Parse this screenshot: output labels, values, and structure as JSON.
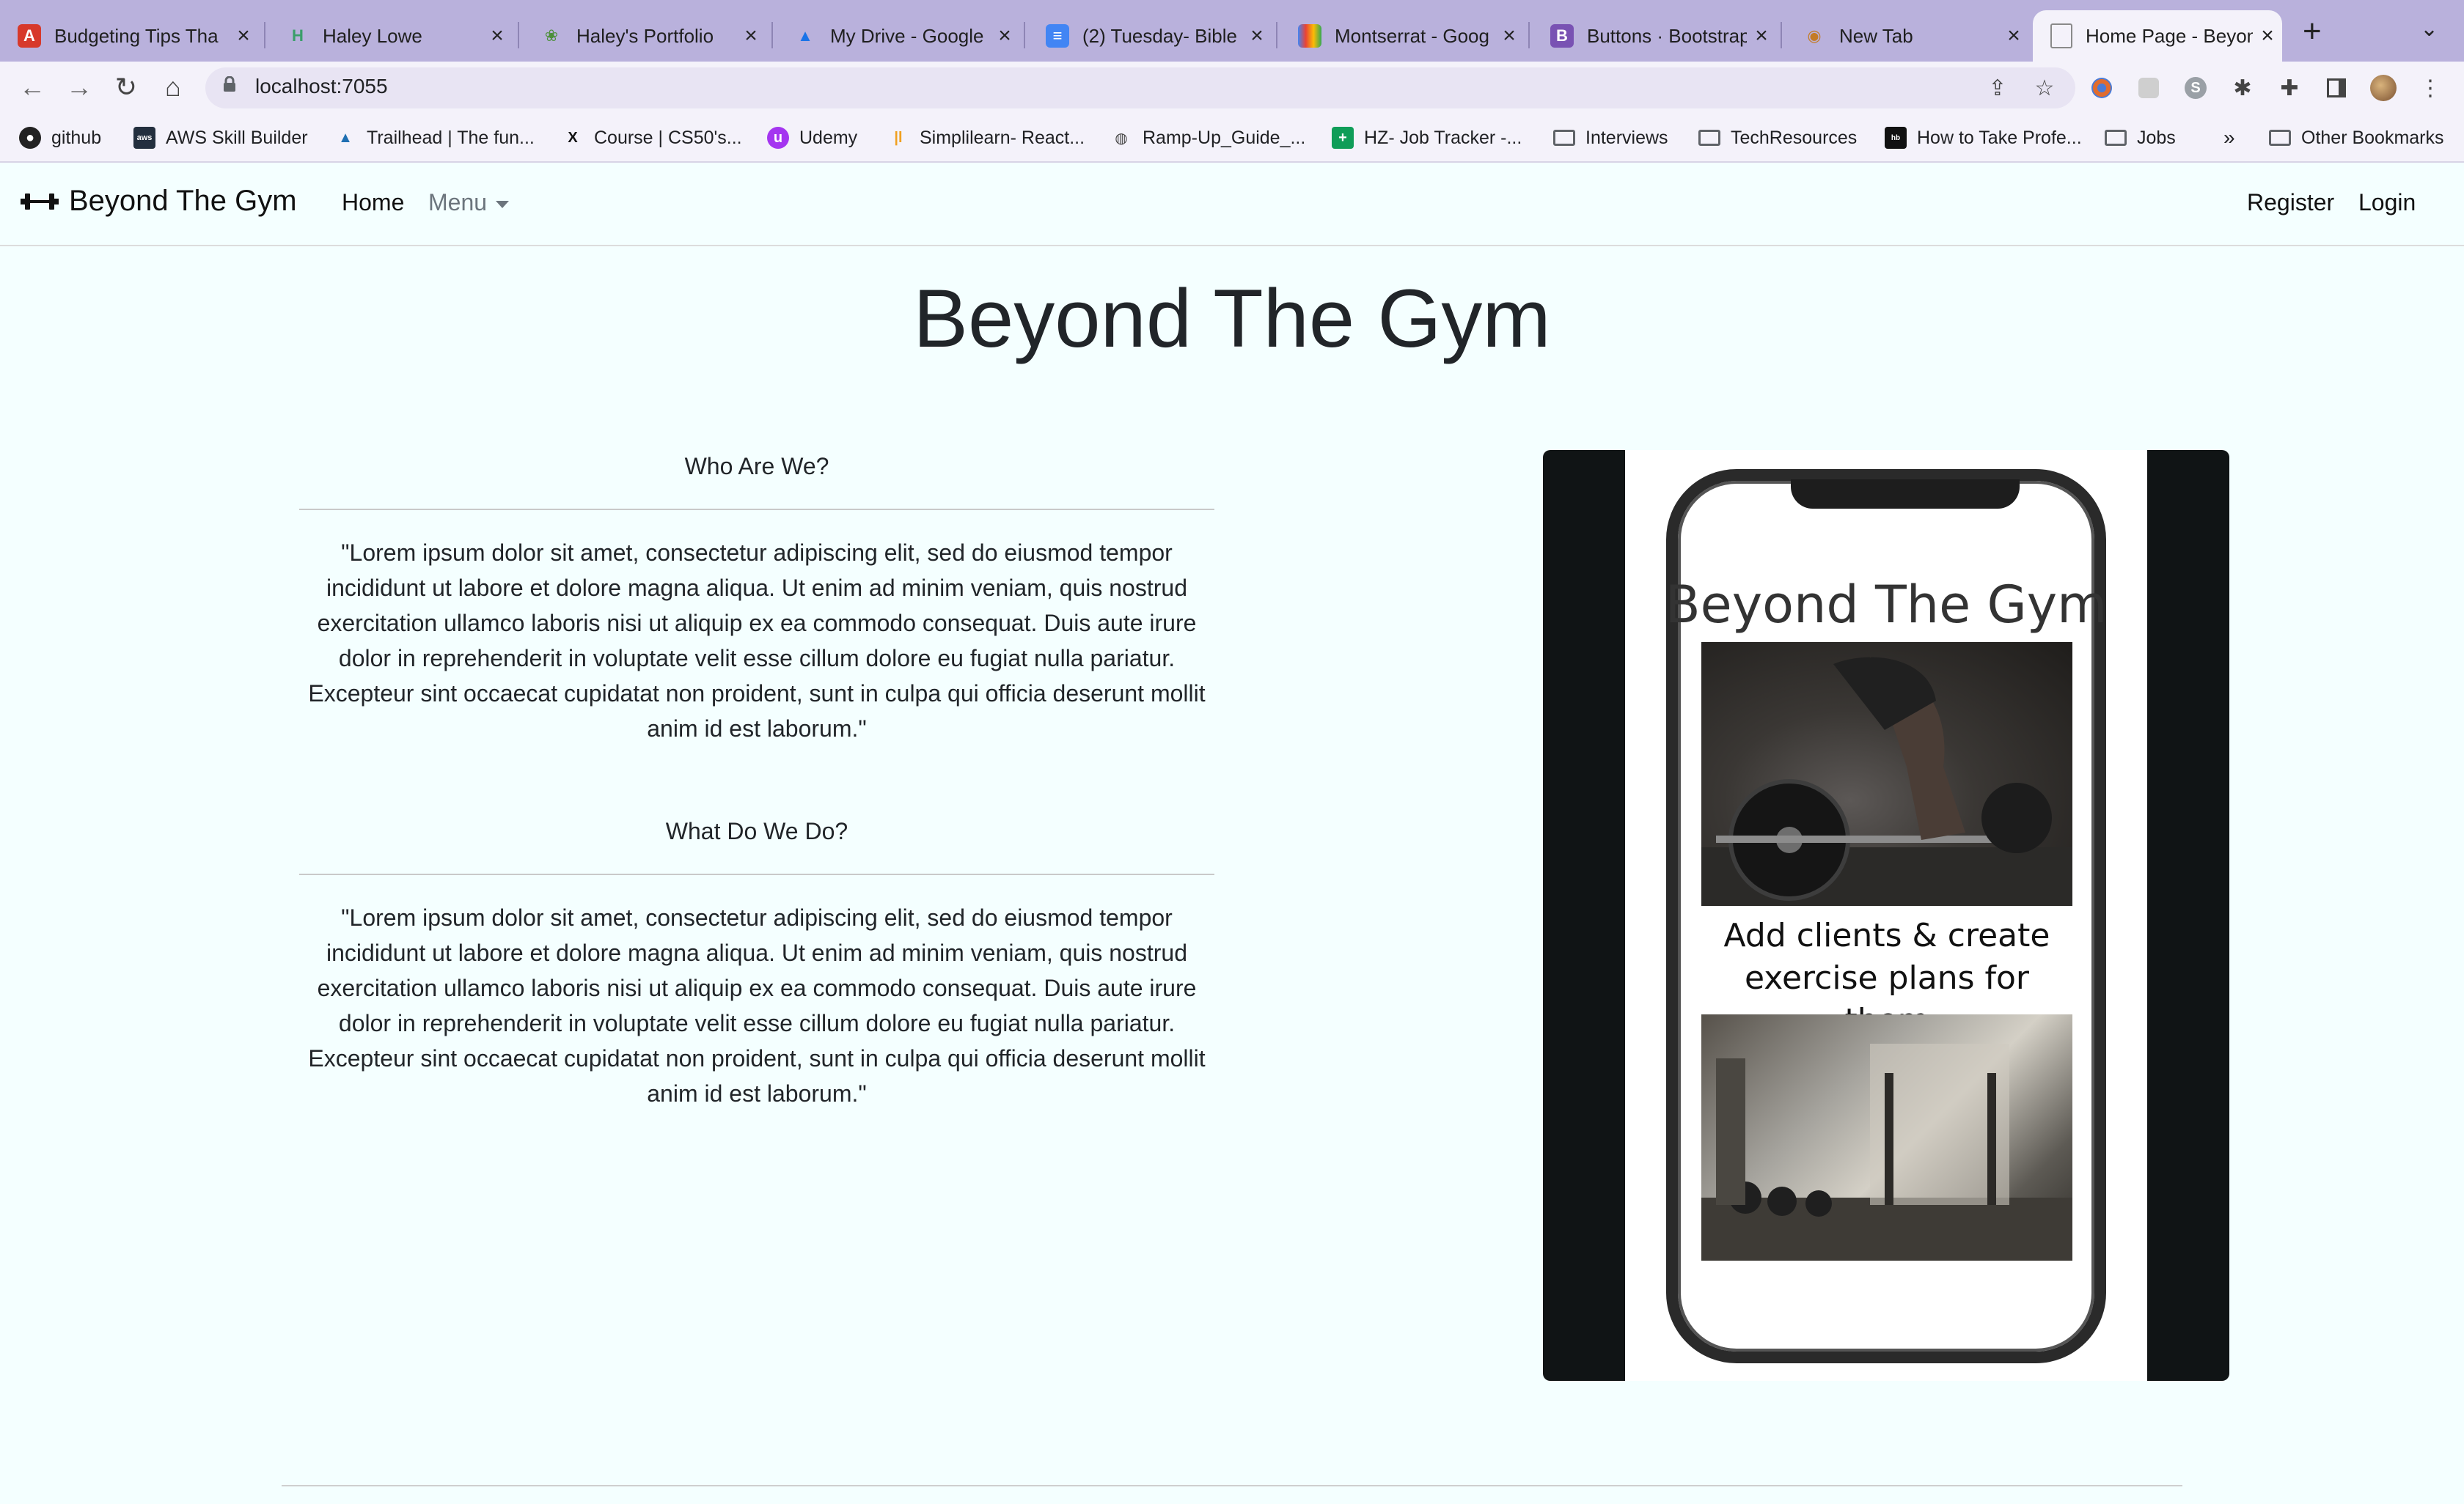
{
  "browser": {
    "tabs": [
      {
        "title": "Budgeting Tips Tha",
        "icon": "adobe-icon",
        "color": "#d7392b",
        "glyph": "A"
      },
      {
        "title": "Haley Lowe",
        "icon": "h-logo-icon",
        "color": "#3a9e6a",
        "glyph": "H"
      },
      {
        "title": "Haley's Portfolio",
        "icon": "plant-icon",
        "color": "#4c8f3a",
        "glyph": "❀"
      },
      {
        "title": "My Drive - Google",
        "icon": "drive-icon",
        "color": "#1a73e8",
        "glyph": "▲"
      },
      {
        "title": "(2) Tuesday- Bible",
        "icon": "docs-icon",
        "color": "#4285f4",
        "glyph": "≡"
      },
      {
        "title": "Montserrat - Goog",
        "icon": "fonts-icon",
        "color": "#ea4335",
        "glyph": "▮"
      },
      {
        "title": "Buttons · Bootstrap",
        "icon": "bootstrap-icon",
        "color": "#7952b3",
        "glyph": "B"
      },
      {
        "title": "New Tab",
        "icon": "newtab-icon",
        "color": "#c47b26",
        "glyph": "◉"
      },
      {
        "title": "Home Page - Beyon",
        "icon": "page-icon",
        "color": "#8a8a8a",
        "glyph": "▤"
      }
    ],
    "url": "localhost:7055",
    "bookmarks": [
      {
        "label": "github",
        "icon": "github-icon"
      },
      {
        "label": "AWS Skill Builder",
        "icon": "aws-icon"
      },
      {
        "label": "Trailhead | The fun...",
        "icon": "trailhead-icon"
      },
      {
        "label": "Course | CS50's...",
        "icon": "edx-icon"
      },
      {
        "label": "Udemy",
        "icon": "udemy-icon"
      },
      {
        "label": "Simplilearn- React...",
        "icon": "simplilearn-icon"
      },
      {
        "label": "Ramp-Up_Guide_...",
        "icon": "globe-icon"
      },
      {
        "label": "HZ- Job Tracker -...",
        "icon": "sheets-icon"
      },
      {
        "label": "Interviews",
        "icon": "folder-icon"
      },
      {
        "label": "TechResources",
        "icon": "folder-icon"
      },
      {
        "label": "How to Take Profe...",
        "icon": "site-icon"
      },
      {
        "label": "Jobs",
        "icon": "folder-icon"
      }
    ],
    "bookmarks_overflow": "»",
    "other_bookmarks": "Other Bookmarks"
  },
  "site": {
    "brand": "Beyond The Gym",
    "nav": {
      "home": "Home",
      "menu": "Menu",
      "register": "Register",
      "login": "Login"
    },
    "hero_title": "Beyond The Gym",
    "sections": [
      {
        "heading": "Who Are We?",
        "body": "\"Lorem ipsum dolor sit amet, consectetur adipiscing elit, sed do eiusmod tempor incididunt ut labore et dolore magna aliqua. Ut enim ad minim veniam, quis nostrud exercitation ullamco laboris nisi ut aliquip ex ea commodo consequat. Duis aute irure dolor in reprehenderit in voluptate velit esse cillum dolore eu fugiat nulla pariatur. Excepteur sint occaecat cupidatat non proident, sunt in culpa qui officia deserunt mollit anim id est laborum.\""
      },
      {
        "heading": "What Do We Do?",
        "body": "\"Lorem ipsum dolor sit amet, consectetur adipiscing elit, sed do eiusmod tempor incididunt ut labore et dolore magna aliqua. Ut enim ad minim veniam, quis nostrud exercitation ullamco laboris nisi ut aliquip ex ea commodo consequat. Duis aute irure dolor in reprehenderit in voluptate velit esse cillum dolore eu fugiat nulla pariatur. Excepteur sint occaecat cupidatat non proident, sunt in culpa qui officia deserunt mollit anim id est laborum.\""
      }
    ],
    "phone_mockup": {
      "title": "Beyond The Gym",
      "caption": "Add clients & create exercise plans for them"
    }
  },
  "colors": {
    "page_bg": "#f4ffff",
    "tabstrip": "#b9b1dc",
    "panel_dark": "#101415"
  }
}
